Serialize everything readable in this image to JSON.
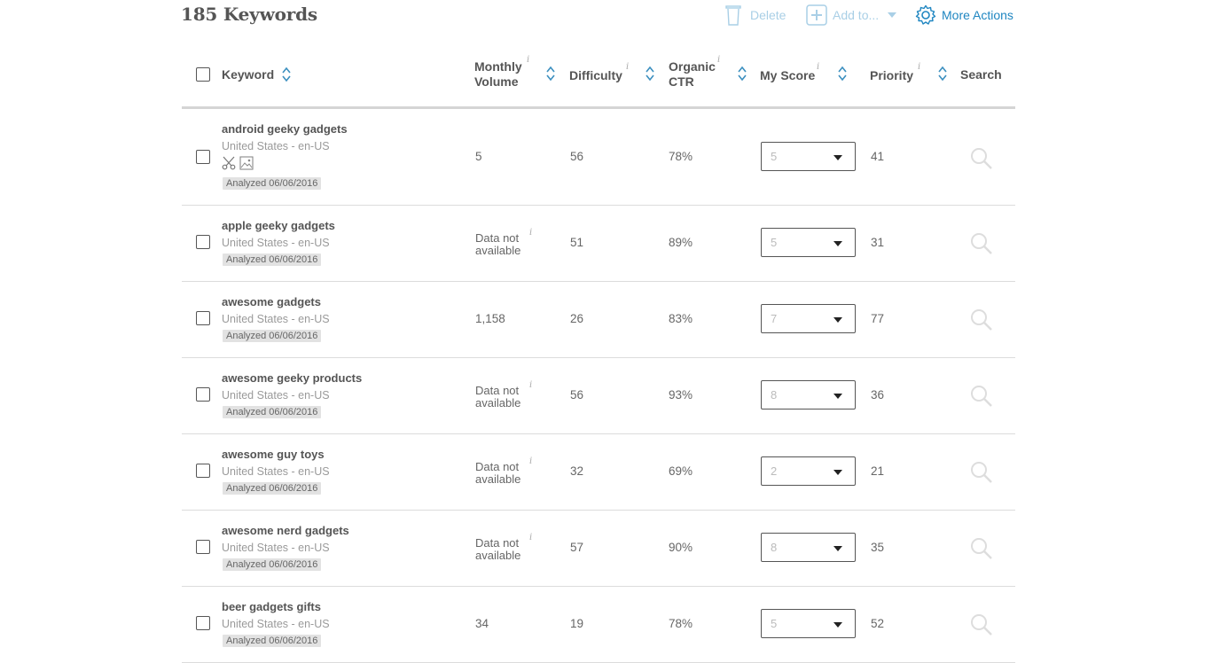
{
  "header": {
    "title": "185 Keywords",
    "delete_label": "Delete",
    "add_label": "Add to...",
    "more_label": "More Actions"
  },
  "columns": {
    "keyword": "Keyword",
    "volume_l1": "Monthly",
    "volume_l2": "Volume",
    "difficulty": "Difficulty",
    "ctr_l1": "Organic",
    "ctr_l2": "CTR",
    "score": "My Score",
    "priority": "Priority",
    "search": "Search",
    "info_glyph": "i"
  },
  "rows": [
    {
      "keyword": "android geeky gadgets",
      "location": "United States - en-US",
      "analyzed": "Analyzed 06/06/2016",
      "volume": "5",
      "difficulty": "56",
      "ctr": "78%",
      "score": "5",
      "priority": "41"
    },
    {
      "keyword": "apple geeky gadgets",
      "location": "United States - en-US",
      "analyzed": "Analyzed 06/06/2016",
      "volume_na_1": "Data not",
      "volume_na_2": "available",
      "difficulty": "51",
      "ctr": "89%",
      "score": "5",
      "priority": "31"
    },
    {
      "keyword": "awesome gadgets",
      "location": "United States - en-US",
      "analyzed": "Analyzed 06/06/2016",
      "volume": "1,158",
      "difficulty": "26",
      "ctr": "83%",
      "score": "7",
      "priority": "77"
    },
    {
      "keyword": "awesome geeky products",
      "location": "United States - en-US",
      "analyzed": "Analyzed 06/06/2016",
      "volume_na_1": "Data not",
      "volume_na_2": "available",
      "difficulty": "56",
      "ctr": "93%",
      "score": "8",
      "priority": "36"
    },
    {
      "keyword": "awesome guy toys",
      "location": "United States - en-US",
      "analyzed": "Analyzed 06/06/2016",
      "volume_na_1": "Data not",
      "volume_na_2": "available",
      "difficulty": "32",
      "ctr": "69%",
      "score": "2",
      "priority": "21"
    },
    {
      "keyword": "awesome nerd gadgets",
      "location": "United States - en-US",
      "analyzed": "Analyzed 06/06/2016",
      "volume_na_1": "Data not",
      "volume_na_2": "available",
      "difficulty": "57",
      "ctr": "90%",
      "score": "8",
      "priority": "35"
    },
    {
      "keyword": "beer gadgets gifts",
      "location": "United States - en-US",
      "analyzed": "Analyzed 06/06/2016",
      "volume": "34",
      "difficulty": "19",
      "ctr": "78%",
      "score": "5",
      "priority": "52"
    }
  ],
  "icons": {
    "delete": "trash-icon",
    "add": "plus-box-icon",
    "more": "gear-icon",
    "sort": "sort-arrows-icon",
    "search": "magnifier-icon",
    "tools": [
      "scissors-icon",
      "image-icon"
    ]
  },
  "colors": {
    "accent": "#1f86c1",
    "accent_muted": "#a9cfe6",
    "sort_arrow": "#3b8fbf"
  }
}
